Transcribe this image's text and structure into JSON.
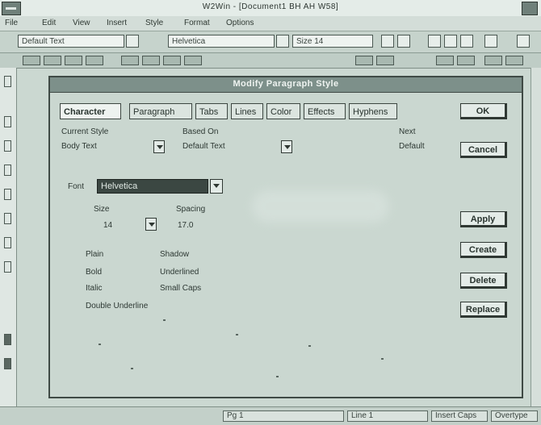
{
  "window": {
    "title": "W2Win - [Document1 BH AH W58]"
  },
  "menubar": {
    "items": [
      "File",
      "Edit",
      "View",
      "Insert",
      "Style",
      "Format",
      "Options"
    ]
  },
  "toolbar": {
    "style_field": "Default Text",
    "font_field": "Helvetica",
    "size_field": "Size 14"
  },
  "statusbar": {
    "left": "Pg 1",
    "middle": "Line 1",
    "right": "Insert  Caps",
    "far_right": "Overtype"
  },
  "dialog": {
    "title": "Modify Paragraph Style",
    "tabs": [
      "Character",
      "Paragraph",
      "Tabs",
      "Lines",
      "Color",
      "Effects",
      "Hyphens"
    ],
    "active_tab": "Character",
    "buttons": {
      "ok": "OK",
      "cancel": "Cancel",
      "apply": "Apply",
      "create": "Create",
      "delete": "Delete",
      "replace": "Replace"
    },
    "labels": {
      "current_style": "Current Style",
      "based_on": "Based On",
      "next": "Next",
      "font": "Font",
      "size": "Size",
      "spacing": "Spacing"
    },
    "values": {
      "current_style": "Body Text",
      "based_on": "Default Text",
      "next": "Default",
      "font": "Helvetica",
      "size": "14",
      "spacing": "17.0"
    },
    "attributes": [
      "Plain",
      "Bold",
      "Italic",
      "Shadow",
      "Underlined",
      "Small Caps"
    ],
    "attributes_extra": "Double Underline"
  }
}
